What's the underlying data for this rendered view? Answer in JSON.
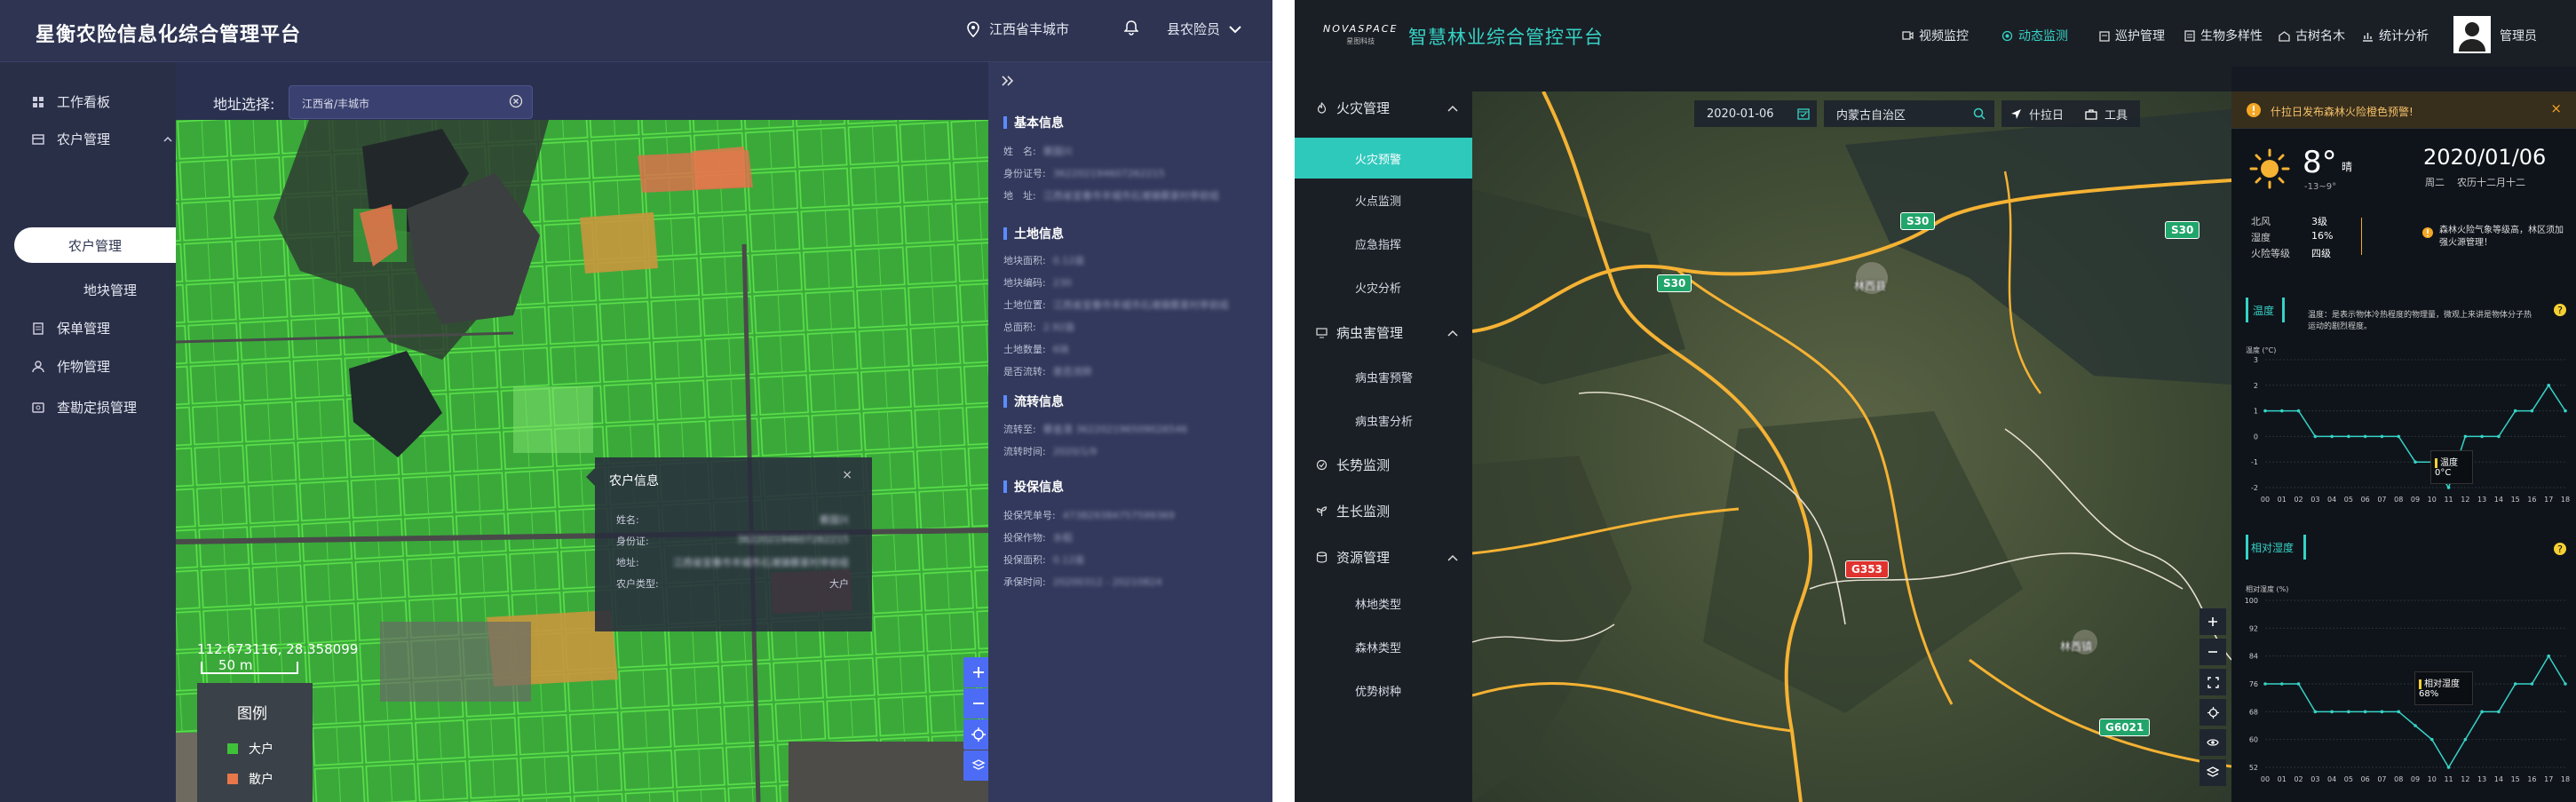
{
  "left_app": {
    "title": "星衡农险信息化综合管理平台",
    "location": "江西省丰城市",
    "role": "县农险员",
    "sidebar": {
      "items": [
        {
          "label": "工作看板"
        },
        {
          "label": "农户管理"
        },
        {
          "label": "保单管理"
        },
        {
          "label": "作物管理"
        },
        {
          "label": "查勘定损管理"
        }
      ],
      "sub_items": [
        {
          "label": "农户管理"
        },
        {
          "label": "地块管理"
        }
      ]
    },
    "address": {
      "label": "地址选择:",
      "value": "江西省/丰城市"
    },
    "info_panel": {
      "sections": [
        {
          "title": "基本信息",
          "rows": [
            {
              "label": "姓　名:",
              "value": "蔡国兴"
            },
            {
              "label": "身份证号:",
              "value": "362202194607262215"
            },
            {
              "label": "地　址:",
              "value": "江西省宜春市丰城市石滩镇蔡家村亭前组"
            }
          ]
        },
        {
          "title": "土地信息",
          "rows": [
            {
              "label": "地块面积:",
              "value": "0.12亩"
            },
            {
              "label": "地块编码:",
              "value": "230"
            },
            {
              "label": "土地位置:",
              "value": "江西省宜春市丰城市石滩镇蔡家村亭前组"
            },
            {
              "label": "总面积:",
              "value": "2.92亩"
            },
            {
              "label": "土地数量:",
              "value": "6块"
            },
            {
              "label": "是否流转:",
              "value": "是否流转"
            }
          ]
        },
        {
          "title": "流转信息",
          "rows": [
            {
              "label": "流转至:",
              "value": "蔡金清 362202196509026546"
            },
            {
              "label": "流转时间:",
              "value": "2020/1/9"
            }
          ]
        },
        {
          "title": "投保信息",
          "rows": [
            {
              "label": "投保凭单号:",
              "value": "473829384757599369"
            },
            {
              "label": "投保作物:",
              "value": "水稻"
            },
            {
              "label": "投保面积:",
              "value": "0.12亩"
            },
            {
              "label": "承保时间:",
              "value": "20200312 - 20210824"
            }
          ]
        }
      ]
    },
    "popup": {
      "title": "农户信息",
      "close": "×",
      "rows": [
        {
          "label": "姓名:",
          "value": "蔡国兴",
          "blur": true
        },
        {
          "label": "身份证:",
          "value": "362202194607262215",
          "blur": true
        },
        {
          "label": "地址:",
          "value": "江西省宜春市丰城市石滩镇蔡家村亭前组",
          "blur": true
        },
        {
          "label": "农户类型:",
          "value": "大户",
          "blur": false
        }
      ]
    },
    "map": {
      "coord": "112.673116, 28.358099",
      "scale": "50 m",
      "legend_title": "图例",
      "legend": [
        {
          "label": "大户",
          "color": "#3fc23a"
        },
        {
          "label": "散户",
          "color": "#e8774a"
        }
      ],
      "expand_icon": "double-chevron-right-icon"
    }
  },
  "right_app": {
    "brand": "NOVASPACE",
    "brand_sub": "星图科技",
    "title": "智慧林业综合管控平台",
    "nav": [
      {
        "label": "视频监控",
        "icon": "video-icon"
      },
      {
        "label": "动态监测",
        "icon": "radar-icon"
      },
      {
        "label": "巡护管理",
        "icon": "clipboard-icon"
      },
      {
        "label": "生物多样性",
        "icon": "leaf-icon"
      },
      {
        "label": "古树名木",
        "icon": "tree-icon"
      },
      {
        "label": "统计分析",
        "icon": "chart-icon"
      }
    ],
    "user": "管理员",
    "sidebar": [
      {
        "label": "火灾管理",
        "expanded": true,
        "children": [
          "火灾预警",
          "火点监测",
          "应急指挥",
          "火灾分析"
        ]
      },
      {
        "label": "病虫害管理",
        "expanded": true,
        "children": [
          "病虫害预警",
          "病虫害分析"
        ]
      },
      {
        "label": "长势监测",
        "expanded": false,
        "children": []
      },
      {
        "label": "生长监测",
        "expanded": false,
        "children": []
      },
      {
        "label": "资源管理",
        "expanded": true,
        "children": [
          "林地类型",
          "森林类型",
          "优势树种"
        ]
      }
    ],
    "toolbar": {
      "date": "2020-01-06",
      "region": "内蒙古自治区",
      "place": "什拉日",
      "tools": "工具"
    },
    "map_labels": {
      "badges": [
        {
          "text": "S30",
          "color": "#21a56b"
        },
        {
          "text": "S30",
          "color": "#21a56b"
        },
        {
          "text": "S30",
          "color": "#21a56b"
        },
        {
          "text": "G353",
          "color": "#e0332f"
        },
        {
          "text": "G6021",
          "color": "#21a56b"
        }
      ],
      "places": [
        "林西县",
        "林西镇"
      ]
    },
    "alert": "什拉日发布森林火险橙色预警!",
    "weather": {
      "temp": "8°",
      "cond": "晴",
      "range": "-13~9°",
      "date": "2020/01/06",
      "weekday": "周二",
      "lunar": "农历十二月十二",
      "wind_label": "北风",
      "wind": "3级",
      "humidity_label": "湿度",
      "humidity": "16%",
      "fire_label": "火险等级",
      "fire": "四级",
      "warning": "森林火险气象等级高，林区须加强火源管理！"
    },
    "chart_temp": {
      "title": "温度",
      "tooltip_text": "温度：是表示物体冷热程度的物理量，微观上来讲是物体分子热运动的剧烈程度。",
      "unit": "温度 (°C)",
      "tip_label": "温度",
      "tip_value": "0°C"
    },
    "chart_hum": {
      "title": "相对湿度",
      "unit": "相对湿度 (%)",
      "tip_label": "相对湿度",
      "tip_value": "68%"
    }
  },
  "chart_data": [
    {
      "type": "line",
      "title": "温度",
      "ylabel": "温度 (°C)",
      "x": [
        "00",
        "01",
        "02",
        "03",
        "04",
        "05",
        "06",
        "07",
        "08",
        "09",
        "10",
        "11",
        "12",
        "13",
        "14",
        "15",
        "16",
        "17",
        "18"
      ],
      "values": [
        1,
        1,
        1,
        0,
        0,
        0,
        0,
        0,
        0,
        -1,
        -1,
        -2,
        0,
        0,
        0,
        1,
        1,
        2,
        1
      ],
      "ylim": [
        -2,
        3
      ],
      "yticks": [
        -2,
        -1,
        0,
        1,
        2,
        3
      ]
    },
    {
      "type": "line",
      "title": "相对湿度",
      "ylabel": "相对湿度 (%)",
      "x": [
        "00",
        "01",
        "02",
        "03",
        "04",
        "05",
        "06",
        "07",
        "08",
        "09",
        "10",
        "11",
        "12",
        "13",
        "14",
        "15",
        "16",
        "17",
        "18"
      ],
      "values": [
        76,
        76,
        76,
        68,
        68,
        68,
        68,
        68,
        68,
        64,
        60,
        52,
        60,
        68,
        68,
        76,
        76,
        84,
        76
      ],
      "ylim": [
        52,
        100
      ],
      "yticks": [
        52,
        60,
        68,
        76,
        84,
        92,
        100
      ]
    }
  ]
}
